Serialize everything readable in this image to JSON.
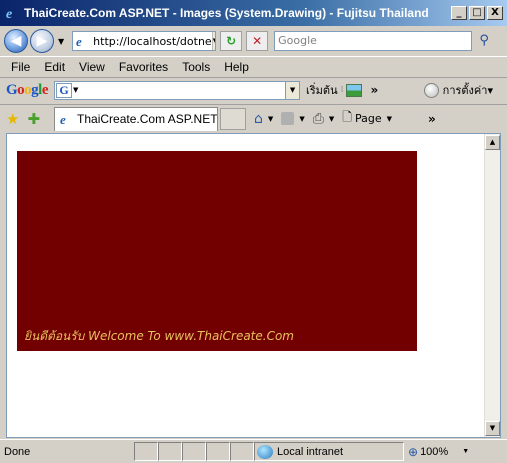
{
  "window": {
    "title": "ThaiCreate.Com ASP.NET - Images (System.Drawing) - Fujitsu Thailand",
    "minimize": "_",
    "maximize": "□",
    "close": "X"
  },
  "address_bar": {
    "url": "http://localhost/dotne",
    "search_placeholder": "Google"
  },
  "menu": [
    "File",
    "Edit",
    "View",
    "Favorites",
    "Tools",
    "Help"
  ],
  "google_toolbar": {
    "logo_letters": [
      "G",
      "o",
      "o",
      "g",
      "l",
      "e"
    ],
    "search_button": "เริ่มต้น",
    "settings_label": "การตั้งค่า▾",
    "more": "»"
  },
  "tabs": [
    {
      "label": "ThaiCreate.Com ASP.NET ..."
    }
  ],
  "command_bar": {
    "page_label": "Page",
    "more": "»"
  },
  "page": {
    "banner_color": "#720000",
    "banner_text": "ยินดีต้อนรับ Welcome To www.ThaiCreate.Com",
    "banner_text_color": "#e8c060"
  },
  "status_bar": {
    "status": "Done",
    "zone": "Local intranet",
    "zoom": "100%"
  }
}
